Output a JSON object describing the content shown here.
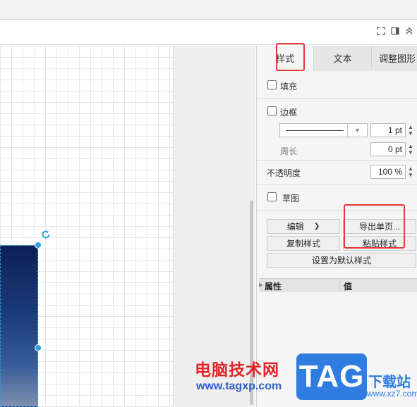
{
  "toolbar": {
    "icons": [
      "fullscreen-icon",
      "format-panel-icon",
      "collapse-icon"
    ]
  },
  "panel": {
    "tabs": [
      {
        "label": "样式",
        "active": true
      },
      {
        "label": "文本",
        "active": false
      },
      {
        "label": "调整图形",
        "active": false
      }
    ],
    "fill_label": "填充",
    "fill_checked": false,
    "border_label": "边框",
    "border_checked": false,
    "border_width": "1 pt",
    "perimeter_label": "周长",
    "perimeter_value": "0 pt",
    "opacity_label": "不透明度",
    "opacity_value": "100 %",
    "sketch_label": "草图",
    "sketch_checked": false,
    "edit_button": "编辑",
    "export_page_button": "导出单页...",
    "copy_style_button": "复制样式",
    "paste_style_button": "粘贴样式",
    "set_default_style_button": "设置为默认样式",
    "properties_header": {
      "name": "属性",
      "value": "值"
    }
  },
  "watermark": {
    "site_name": "电脑技术网",
    "site_url": "www.tagxp.com",
    "tag_logo": "TAG",
    "download_site": "下载站",
    "download_url": "www.xz7.com"
  },
  "colors": {
    "highlight": "#e53935",
    "selection": "#29a6e0",
    "panel_bg": "#f5f5f5"
  }
}
